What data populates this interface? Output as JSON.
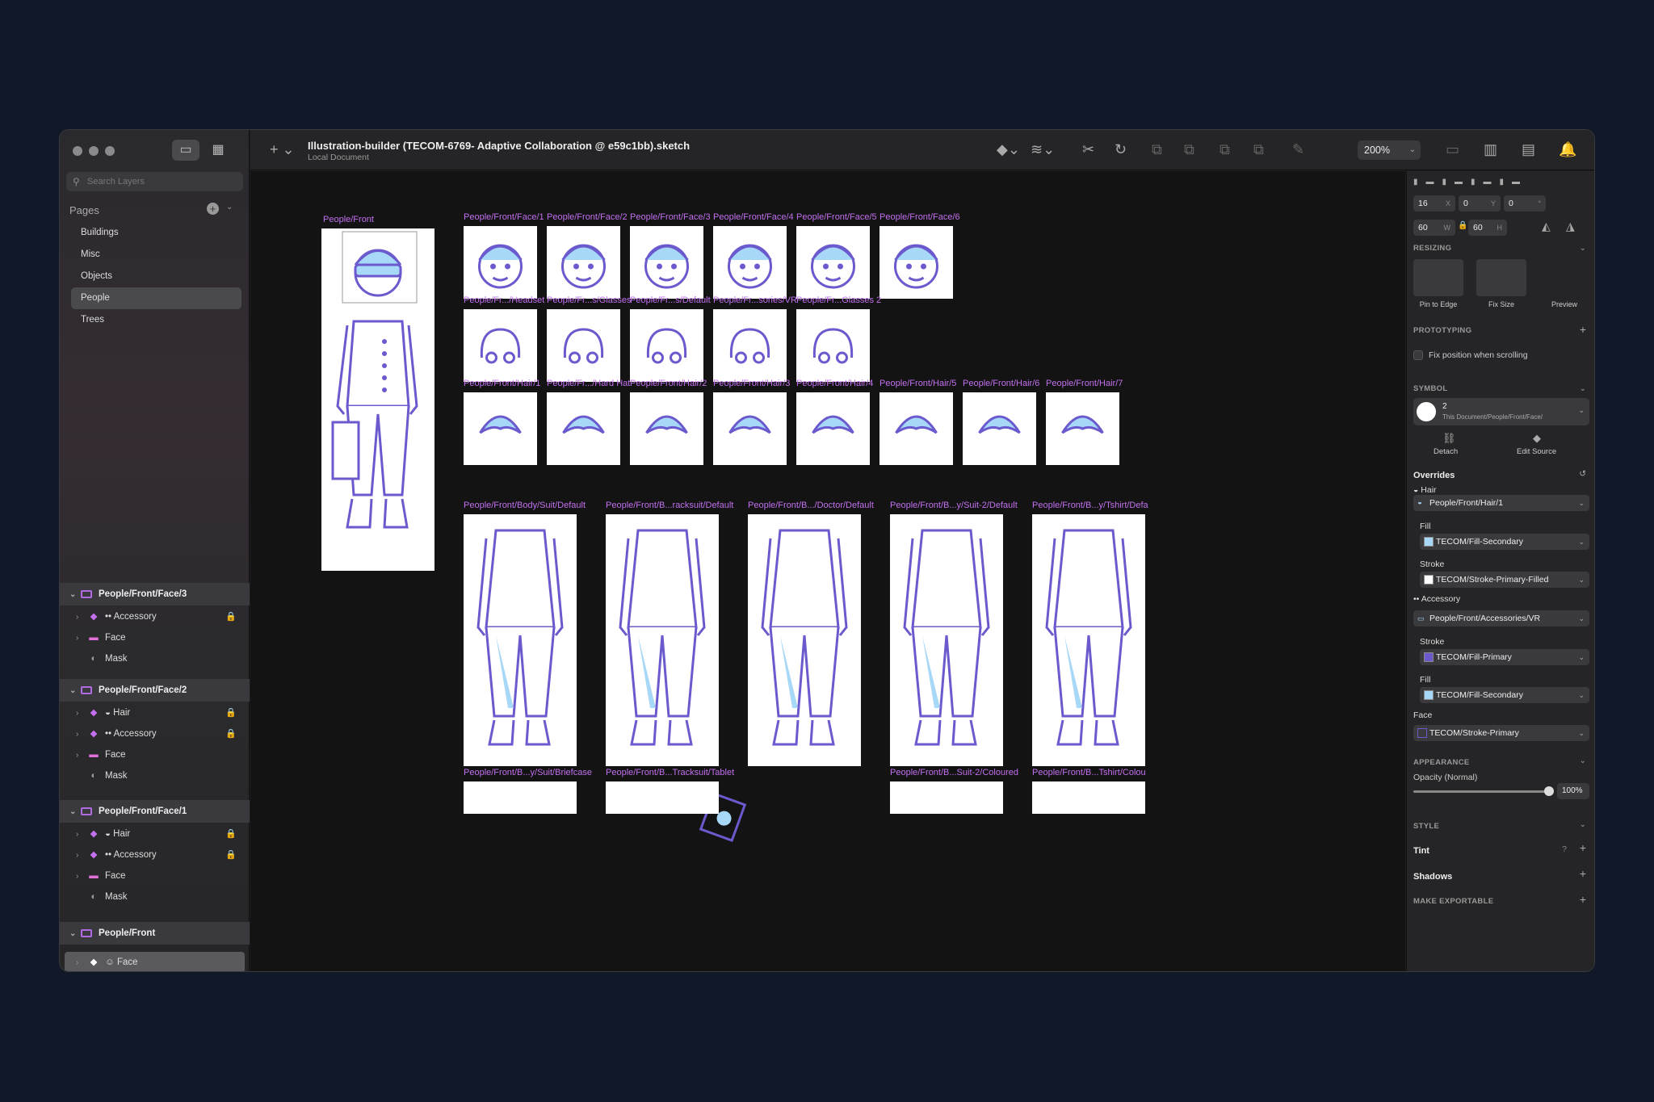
{
  "sidebar": {
    "search_placeholder": "Search Layers",
    "pages_label": "Pages",
    "pages": [
      "Buildings",
      "Misc",
      "Objects",
      "People",
      "Trees"
    ],
    "groups": [
      {
        "title": "People/Front/Face/3",
        "layers": [
          "Accessory",
          "Face",
          "Mask"
        ]
      },
      {
        "title": "People/Front/Face/2",
        "layers": [
          "Hair",
          "Accessory",
          "Face",
          "Mask"
        ]
      },
      {
        "title": "People/Front/Face/1",
        "layers": [
          "Hair",
          "Accessory",
          "Face",
          "Mask"
        ]
      },
      {
        "title": "People/Front",
        "layers": [
          "Face"
        ]
      }
    ]
  },
  "toolbar": {
    "title": "Illustration-builder (TECOM-6769- Adaptive Collaboration @ e59c1bb).sketch",
    "subtitle": "Local Document",
    "zoom": "200%"
  },
  "canvas": {
    "main_artboard": "People/Front",
    "faces": [
      "People/Front/Face/1",
      "People/Front/Face/2",
      "People/Front/Face/3",
      "People/Front/Face/4",
      "People/Front/Face/5",
      "People/Front/Face/6"
    ],
    "accessories": [
      "People/Fr.../Headset",
      "People/Fr...s/Glasses",
      "People/Fr...s/Default",
      "People/Fr...sories/VR",
      "People/Fr...Glasses 2"
    ],
    "hair": [
      "People/Front/Hair/1",
      "People/Fr.../Hard Hat",
      "People/Front/Hair/2",
      "People/Front/Hair/3",
      "People/Front/Hair/4",
      "People/Front/Hair/5",
      "People/Front/Hair/6",
      "People/Front/Hair/7"
    ],
    "bodies": [
      "People/Front/Body/Suit/Default",
      "People/Front/B...racksuit/Default",
      "People/Front/B.../Doctor/Default",
      "People/Front/B...y/Suit-2/Default",
      "People/Front/B...y/Tshirt/Defa"
    ],
    "bodies2": [
      "People/Front/B...y/Suit/Briefcase",
      "People/Front/B...Tracksuit/Tablet",
      "People/Front/B...Suit-2/Coloured",
      "People/Front/B...Tshirt/Colou"
    ]
  },
  "inspector": {
    "x": "16",
    "y": "0",
    "r": "0",
    "w": "60",
    "h": "60",
    "resizing": "RESIZING",
    "pin": "Pin to Edge",
    "fix": "Fix Size",
    "preview": "Preview",
    "prototyping": "PROTOTYPING",
    "fixpos": "Fix position when scrolling",
    "symbol": "SYMBOL",
    "sym_count": "2",
    "sym_path": "This Document/People/Front/Face/",
    "detach": "Detach",
    "edit_source": "Edit Source",
    "overrides": "Overrides",
    "hair": "Hair",
    "hair_val": "People/Front/Hair/1",
    "fill": "Fill",
    "fill_val": "TECOM/Fill-Secondary",
    "stroke": "Stroke",
    "stroke_val": "TECOM/Stroke-Primary-Filled",
    "accessory": "Accessory",
    "acc_val": "People/Front/Accessories/VR",
    "stroke2": "Stroke",
    "stroke2_val": "TECOM/Fill-Primary",
    "fill2": "Fill",
    "fill2_val": "TECOM/Fill-Secondary",
    "face": "Face",
    "face_val": "TECOM/Stroke-Primary",
    "appearance": "APPEARANCE",
    "opacity_label": "Opacity (Normal)",
    "opacity": "100%",
    "style": "STYLE",
    "tint": "Tint",
    "shadows": "Shadows",
    "export": "MAKE EXPORTABLE"
  },
  "colors": {
    "accent": "#c270ee",
    "stroke": "#6a5acd",
    "fill": "#a8d8f8"
  }
}
